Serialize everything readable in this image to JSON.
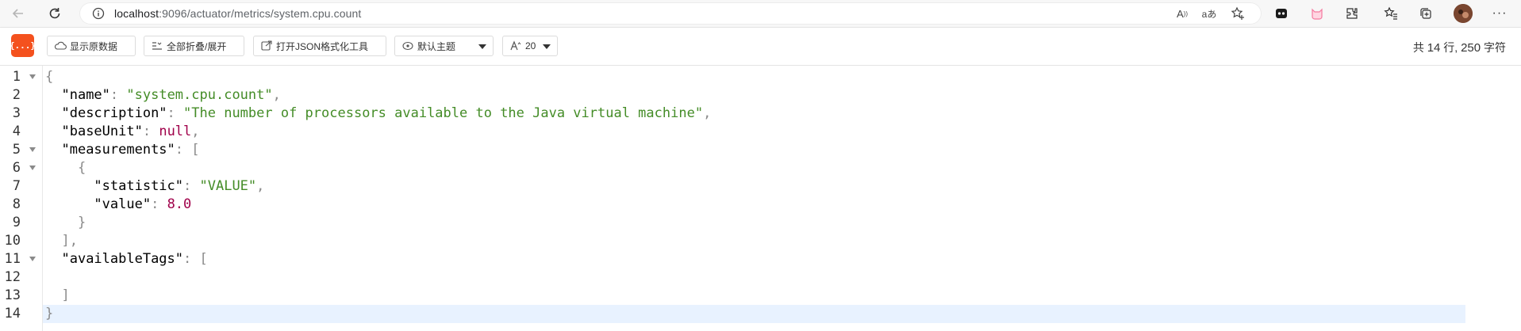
{
  "browser": {
    "url_host": "localhost",
    "url_rest": ":9096/actuator/metrics/system.cpu.count"
  },
  "toolbar": {
    "logo_text": "{...}",
    "raw_label": "显示原数据",
    "fold_label": "全部折叠/展开",
    "json_tool_label": "打开JSON格式化工具",
    "theme_label": "默认主题",
    "font_size_label": "20",
    "stats_prefix": "共",
    "stats_lines": "14",
    "stats_mid": "行,",
    "stats_chars": "250",
    "stats_suffix": "字符"
  },
  "editor": {
    "line_numbers": [
      "1",
      "2",
      "3",
      "4",
      "5",
      "6",
      "7",
      "8",
      "9",
      "10",
      "11",
      "12",
      "13",
      "14"
    ],
    "tokens": {
      "l1_open": "{",
      "l2_key": "\"name\"",
      "l2_val": "\"system.cpu.count\"",
      "l3_key": "\"description\"",
      "l3_val": "\"The number of processors available to the Java virtual machine\"",
      "l4_key": "\"baseUnit\"",
      "l4_val": "null",
      "l5_key": "\"measurements\"",
      "l5_open": "[",
      "l6_open": "{",
      "l7_key": "\"statistic\"",
      "l7_val": "\"VALUE\"",
      "l8_key": "\"value\"",
      "l8_val": "8.0",
      "l9_close": "}",
      "l10_close": "],",
      "l11_key": "\"availableTags\"",
      "l11_open": "[",
      "l13_close": "]",
      "l14_close": "}"
    }
  },
  "colors": {
    "logo": "#f4511e",
    "string": "#448c27",
    "number_null": "#a0004a",
    "active_line": "#e8f2ff"
  }
}
